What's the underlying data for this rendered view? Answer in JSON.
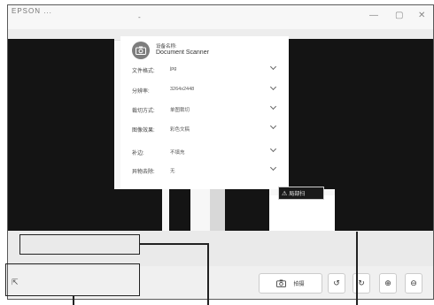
{
  "titlebar": {
    "title": "EPSON ...",
    "mid_mark": "-",
    "minimize": "—",
    "maximize": "▢",
    "close": "✕"
  },
  "device": {
    "label": "设备名称:",
    "name": "Document Scanner"
  },
  "settings": [
    {
      "label": "文件格式:",
      "value": "jpg"
    },
    {
      "label": "分辨率:",
      "value": "3264x2448"
    },
    {
      "label": "裁切方式:",
      "value": "单图裁切"
    },
    {
      "label": "图像效果:",
      "value": "彩色文稿"
    },
    {
      "label": "补边:",
      "value": "不填充"
    },
    {
      "label": "异物去除:",
      "value": "无"
    }
  ],
  "tooltip": {
    "icon": "warning-icon",
    "text": "局部扫"
  },
  "bottombar": {
    "scan_label": "拍摄",
    "icons": [
      "expand-icon",
      "camera-icon",
      "rotate-left-icon",
      "rotate-right-icon",
      "zoom-in-icon",
      "zoom-out-icon"
    ]
  }
}
